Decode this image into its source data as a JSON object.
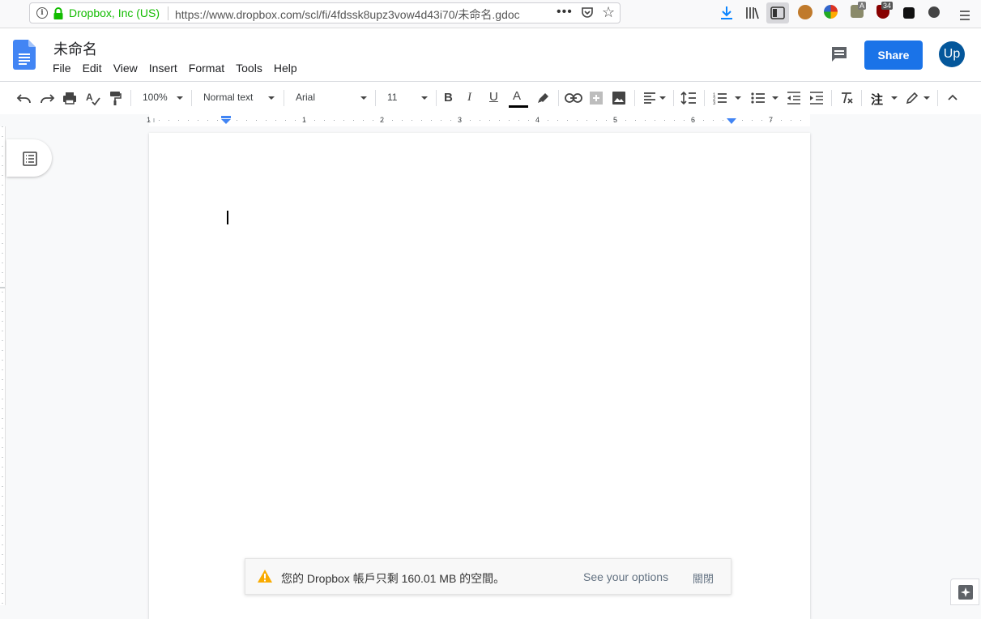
{
  "browser": {
    "org_name": "Dropbox, Inc (US)",
    "url": "https://www.dropbox.com/scl/fi/4fdssk8upz3vow4d43i70/未命名.gdoc",
    "ext_badge_a": "A",
    "ext_badge_count": "34"
  },
  "doc": {
    "title": "未命名",
    "menu": [
      "File",
      "Edit",
      "View",
      "Insert",
      "Format",
      "Tools",
      "Help"
    ],
    "share_label": "Share",
    "avatar_initials": "Up"
  },
  "toolbar": {
    "zoom": "100%",
    "style": "Normal text",
    "font": "Arial",
    "font_size": "11",
    "input_tool": "注"
  },
  "ruler": {
    "numbers": [
      "1",
      "1",
      "2",
      "3",
      "4",
      "5",
      "6",
      "7"
    ]
  },
  "notification": {
    "message": "您的 Dropbox 帳戶只剩 160.01 MB 的空間。",
    "link": "See your options",
    "close": "關閉"
  },
  "colors": {
    "share_blue": "#1a73e8",
    "avatar_blue": "#04579b",
    "secure_green": "#12bc00",
    "warning_yellow": "#f9ab00"
  }
}
